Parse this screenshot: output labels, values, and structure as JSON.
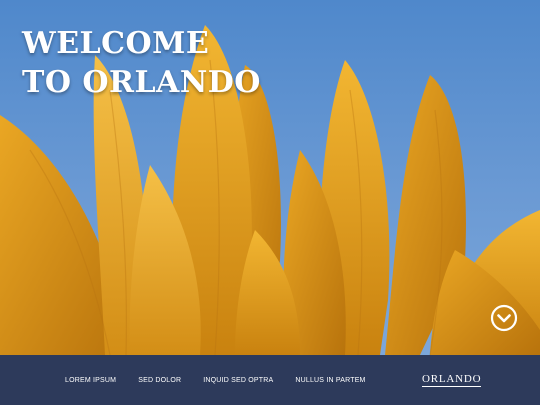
{
  "hero": {
    "headline_line1": "WELCOME",
    "headline_line2": "TO ORLANDO",
    "scroll_icon": "chevron-down-circle-icon"
  },
  "footer": {
    "nav": [
      {
        "label": "LOREM IPSUM"
      },
      {
        "label": "SED DOLOR"
      },
      {
        "label": "INQUID SED OPTRA"
      },
      {
        "label": "NULLUS IN PARTEM"
      }
    ],
    "brand": "ORLANDO"
  },
  "colors": {
    "sky": "#5b8fcf",
    "petal": "#e8a21c",
    "footer": "#2d3a5b",
    "text": "#ffffff"
  }
}
